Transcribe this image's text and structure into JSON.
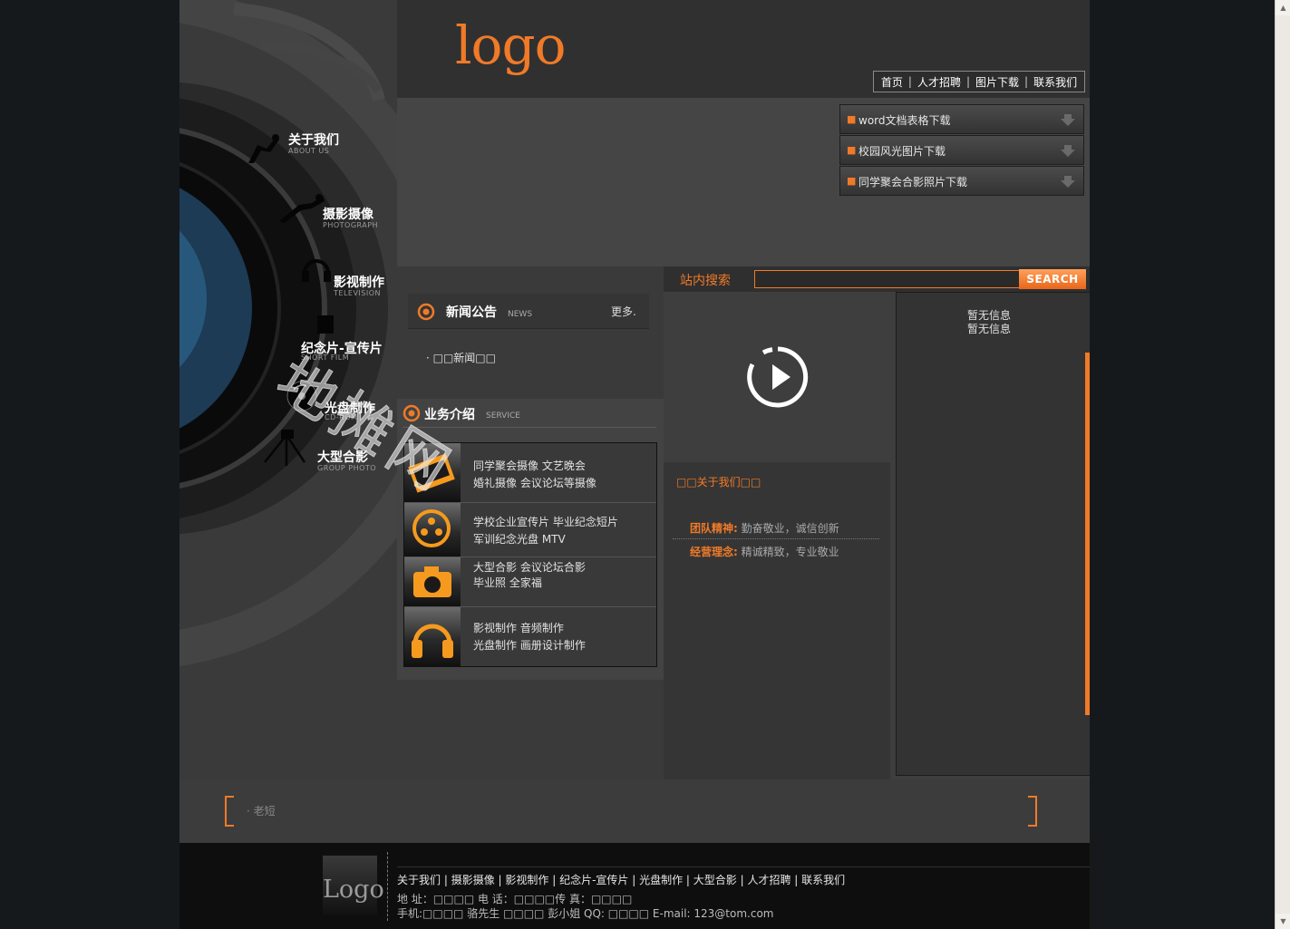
{
  "header": {
    "logo": "logo",
    "topnav": [
      "首页",
      "人才招聘",
      "图片下载",
      "联系我们"
    ]
  },
  "left_nav": [
    {
      "cn": "关于我们",
      "en": "ABOUT US"
    },
    {
      "cn": "摄影摄像",
      "en": "PHOTOGRAPH"
    },
    {
      "cn": "影视制作",
      "en": "TELEVISION"
    },
    {
      "cn": "纪念片-宣传片",
      "en": "SHORT FILM"
    },
    {
      "cn": "光盘制作",
      "en": "CD-ROM"
    },
    {
      "cn": "大型合影",
      "en": "GROUP PHOTO"
    }
  ],
  "downloads": [
    "word文档表格下载",
    "校园风光图片下载",
    "同学聚会合影照片下载"
  ],
  "news": {
    "title": "新闻公告",
    "en": "NEWS",
    "more": "更多.",
    "items": [
      "· □□新闻□□"
    ]
  },
  "service": {
    "title": "业务介绍",
    "en": "SERVICE",
    "rows": [
      {
        "line1": "同学聚会摄像 文艺晚会",
        "line2": "婚礼摄像 会议论坛等摄像"
      },
      {
        "line1": "学校企业宣传片 毕业纪念短片",
        "line2": "军训纪念光盘 MTV"
      },
      {
        "line1": "大型合影 会议论坛合影",
        "line2": "毕业照 全家福"
      },
      {
        "line1": "影视制作 音频制作",
        "line2": "光盘制作 画册设计制作"
      }
    ]
  },
  "search": {
    "label": "站内搜索",
    "placeholder": "",
    "button": "SEARCH"
  },
  "about": {
    "title": "□□关于我们□□",
    "rows": [
      {
        "key": "团队精神:",
        "value": "勤奋敬业，诚信创新"
      },
      {
        "key": "经营理念:",
        "value": "精诚精致，专业敬业"
      }
    ]
  },
  "right_panel": [
    "暂无信息",
    "暂无信息"
  ],
  "ticker": "· 老短",
  "watermark": "地摊网",
  "footer": {
    "logo": "Logo",
    "links": [
      "关于我们",
      "摄影摄像",
      "影视制作",
      "纪念片-宣传片",
      "光盘制作",
      "大型合影",
      "人才招聘",
      "联系我们"
    ],
    "line1": "地 址：□□□□ 电 话：□□□□传 真：□□□□",
    "line2": "手机:□□□□ 骆先生 □□□□ 彭小姐 QQ: □□□□ E-mail: 123@tom.com"
  },
  "colors": {
    "accent": "#f07a28",
    "bg": "#3e3e3e",
    "dark": "#0e0e0e"
  }
}
